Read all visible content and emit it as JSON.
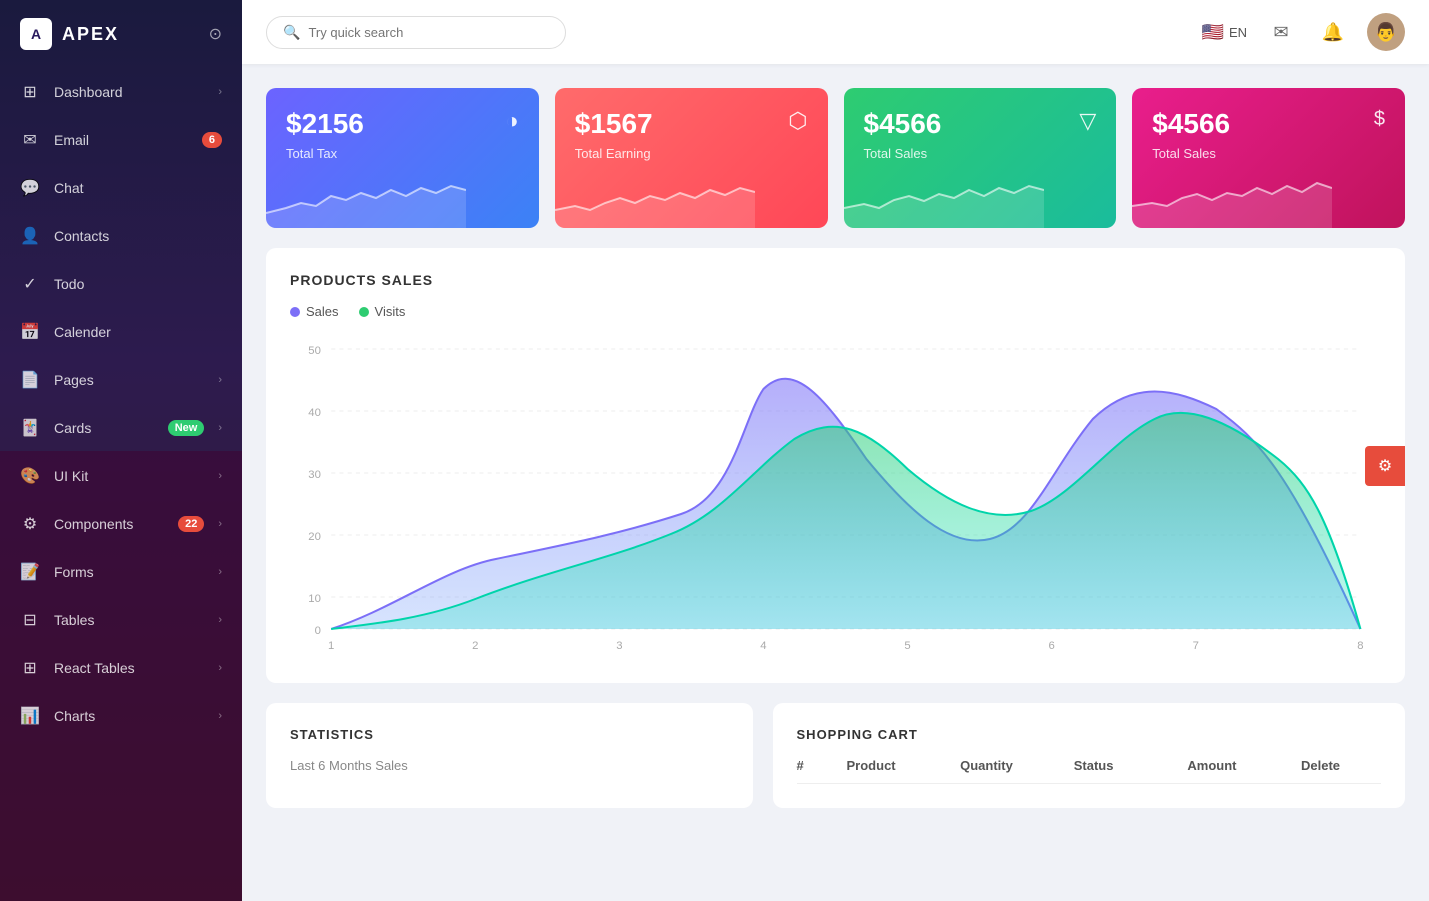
{
  "sidebar": {
    "logo": "A",
    "app_name": "APEX",
    "nav_items": [
      {
        "id": "dashboard",
        "label": "Dashboard",
        "icon": "⊞",
        "arrow": true,
        "badge": null
      },
      {
        "id": "email",
        "label": "Email",
        "icon": "✉",
        "arrow": false,
        "badge": "6",
        "badge_type": "red"
      },
      {
        "id": "chat",
        "label": "Chat",
        "icon": "💬",
        "arrow": false,
        "badge": null
      },
      {
        "id": "contacts",
        "label": "Contacts",
        "icon": "👤",
        "arrow": false,
        "badge": null
      },
      {
        "id": "todo",
        "label": "Todo",
        "icon": "✓",
        "arrow": false,
        "badge": null
      },
      {
        "id": "calender",
        "label": "Calender",
        "icon": "📅",
        "arrow": false,
        "badge": null
      },
      {
        "id": "pages",
        "label": "Pages",
        "icon": "📄",
        "arrow": true,
        "badge": null
      },
      {
        "id": "cards",
        "label": "Cards",
        "icon": "🃏",
        "arrow": true,
        "badge": "New",
        "badge_type": "green"
      },
      {
        "id": "ui-kit",
        "label": "UI Kit",
        "icon": "🎨",
        "arrow": true,
        "badge": null
      },
      {
        "id": "components",
        "label": "Components",
        "icon": "⚙",
        "arrow": true,
        "badge": "22",
        "badge_type": "red"
      },
      {
        "id": "forms",
        "label": "Forms",
        "icon": "📝",
        "arrow": true,
        "badge": null
      },
      {
        "id": "tables",
        "label": "Tables",
        "icon": "⊟",
        "arrow": true,
        "badge": null
      },
      {
        "id": "react-tables",
        "label": "React Tables",
        "icon": "⊞",
        "arrow": true,
        "badge": null
      },
      {
        "id": "charts",
        "label": "Charts",
        "icon": "📊",
        "arrow": true,
        "badge": null
      }
    ]
  },
  "header": {
    "search_placeholder": "Try quick search",
    "language": "EN",
    "flag": "🇺🇸"
  },
  "stat_cards": [
    {
      "id": "card1",
      "value": "$2156",
      "label": "Total Tax",
      "icon": "◑",
      "class": "stat-card-1"
    },
    {
      "id": "card2",
      "value": "$1567",
      "label": "Total Earning",
      "icon": "⬡",
      "class": "stat-card-2"
    },
    {
      "id": "card3",
      "value": "$4566",
      "label": "Total Sales",
      "icon": "▽",
      "class": "stat-card-3"
    },
    {
      "id": "card4",
      "value": "$4566",
      "label": "Total Sales",
      "icon": "$",
      "class": "stat-card-4"
    }
  ],
  "products_chart": {
    "title": "PRODUCTS SALES",
    "legend": [
      {
        "label": "Sales",
        "color": "#7c6ff7"
      },
      {
        "label": "Visits",
        "color": "#2ecc71"
      }
    ],
    "y_labels": [
      "0",
      "10",
      "20",
      "30",
      "40",
      "50"
    ],
    "x_labels": [
      "1",
      "2",
      "3",
      "4",
      "5",
      "6",
      "7",
      "8"
    ]
  },
  "bottom": {
    "statistics": {
      "title": "STATISTICS",
      "subtitle": "Last 6 Months Sales"
    },
    "shopping_cart": {
      "title": "SHOPPING CART",
      "columns": [
        "#",
        "Product",
        "Quantity",
        "Status",
        "Amount",
        "Delete"
      ]
    }
  }
}
